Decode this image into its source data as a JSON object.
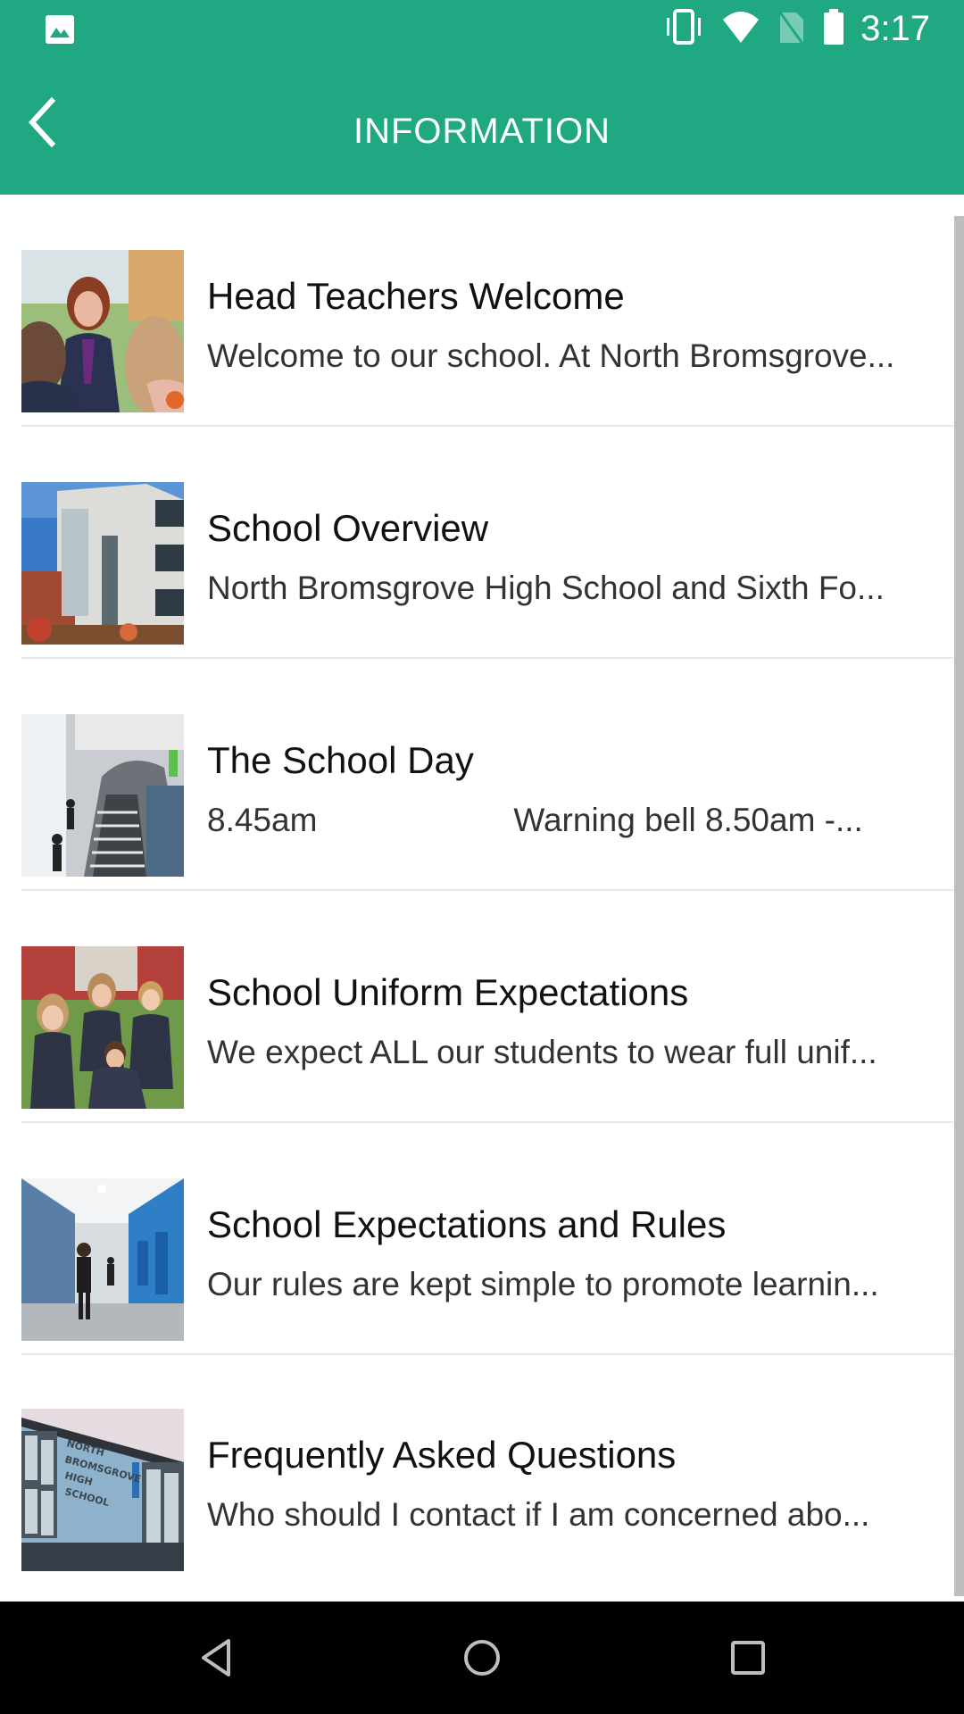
{
  "status_bar": {
    "time": "3:17",
    "left_icon": "image-notification-icon",
    "icons": [
      "vibrate-icon",
      "wifi-icon",
      "no-sim-icon",
      "battery-icon"
    ]
  },
  "app_bar": {
    "title": "INFORMATION",
    "back_icon": "chevron-left-icon"
  },
  "colors": {
    "primary": "#1fa882",
    "divider": "#e6e6e6",
    "nav_bar": "#000000"
  },
  "items": [
    {
      "title": "Head Teachers Welcome",
      "subtitle": "Welcome to our school. At North Bromsgrove...",
      "image": "head-teacher-photo"
    },
    {
      "title": "School Overview",
      "subtitle": "North Bromsgrove High School and Sixth Fo...",
      "image": "school-building-photo"
    },
    {
      "title": "The School Day",
      "subtitle_part1": "8.45am",
      "subtitle_part2": "Warning bell  8.50am -...",
      "image": "staircase-photo"
    },
    {
      "title": "School Uniform Expectations",
      "subtitle": "We expect ALL our students to wear full unif...",
      "image": "students-uniform-photo"
    },
    {
      "title": "School Expectations and Rules",
      "subtitle": "Our rules are kept simple to promote learnin...",
      "image": "corridor-lockers-photo"
    },
    {
      "title": "Frequently Asked Questions",
      "subtitle": "Who should I contact if I am concerned abo...",
      "image": "school-sign-photo",
      "sign_text": "NORTH BROMSGROVE HIGH SCHOOL"
    }
  ],
  "nav_bar": {
    "back": "nav-back-icon",
    "home": "nav-home-icon",
    "recents": "nav-recents-icon"
  }
}
